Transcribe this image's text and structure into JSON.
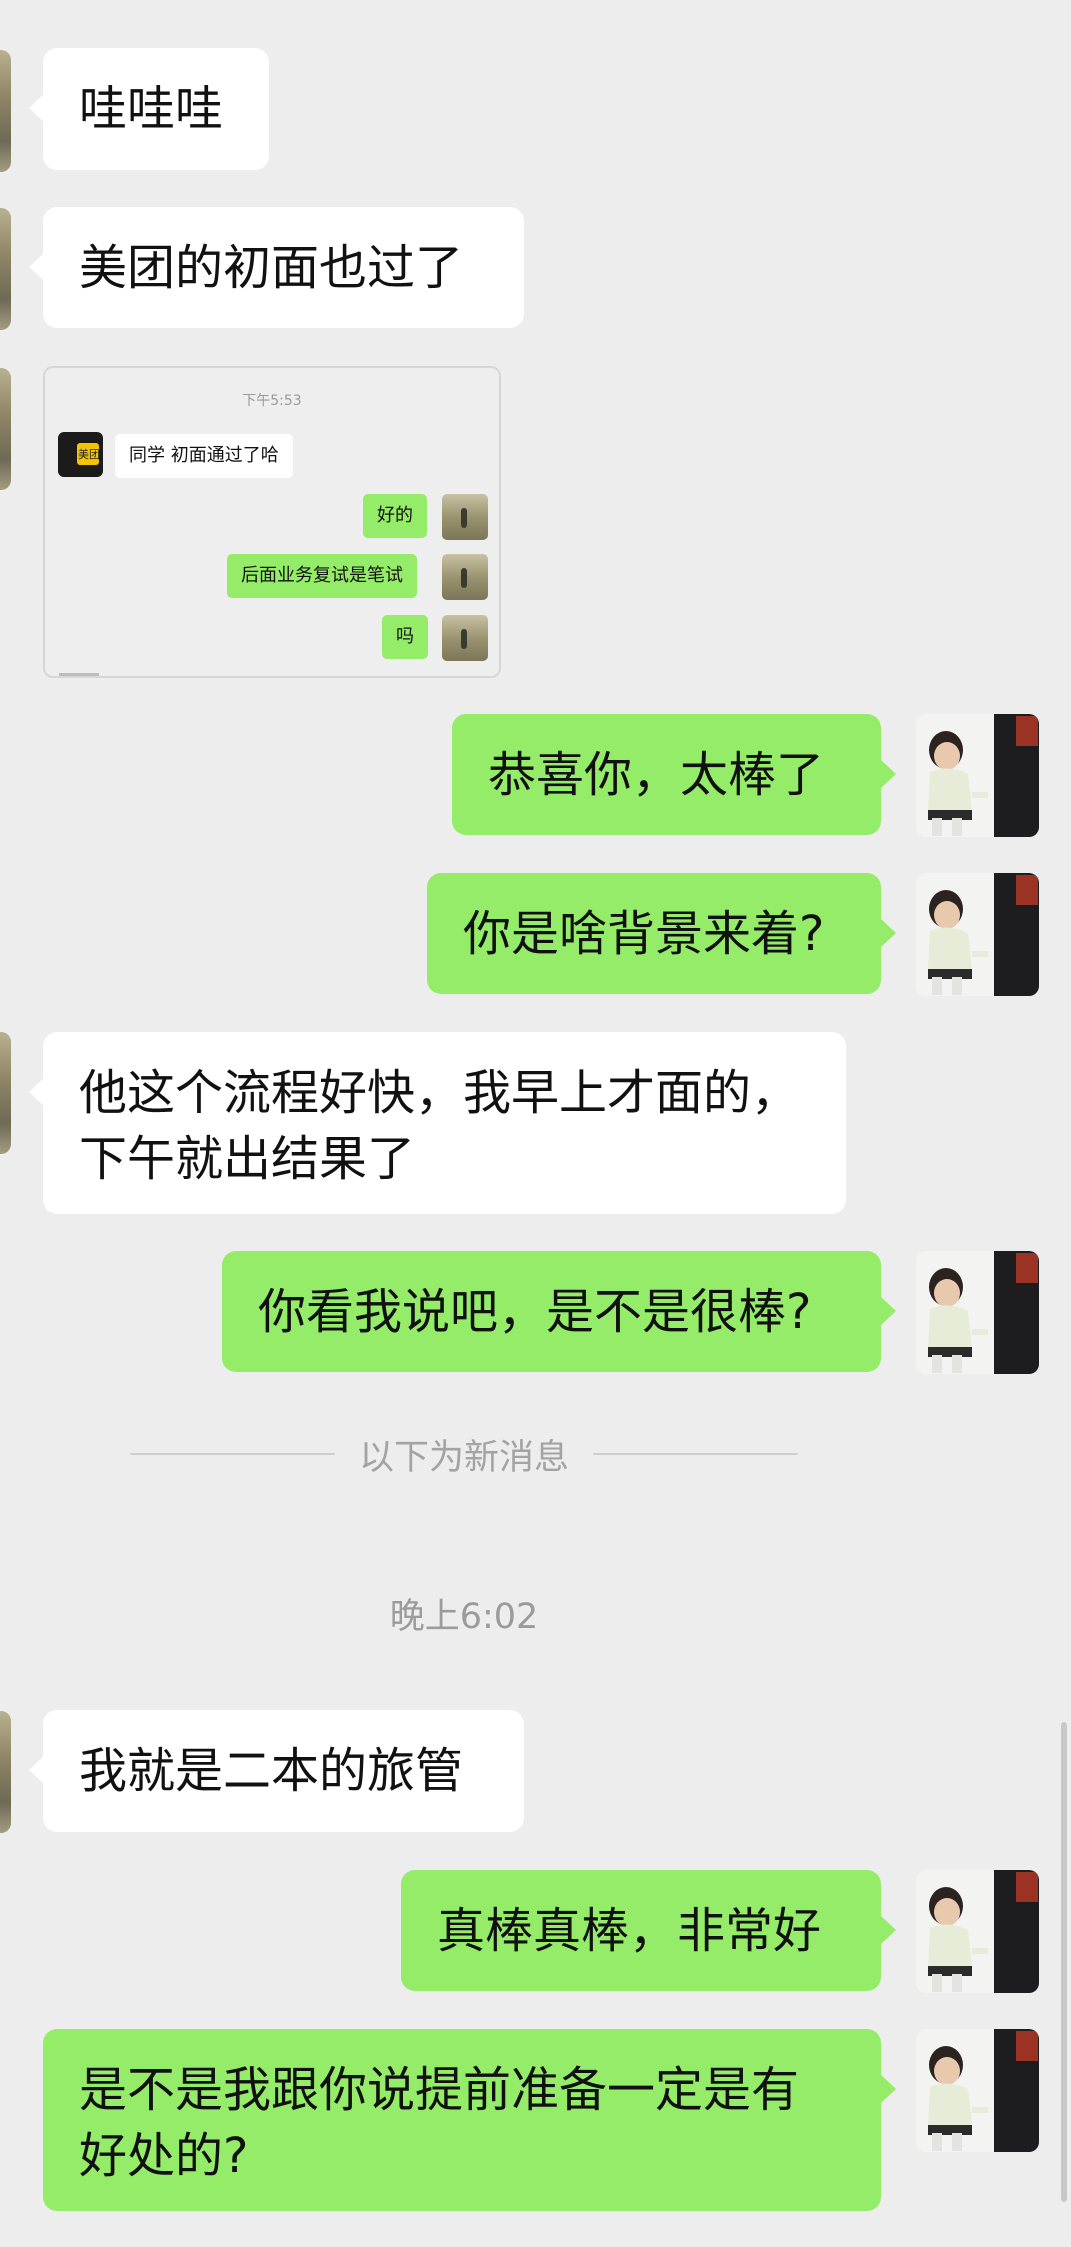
{
  "chat": {
    "messages": [
      {
        "side": "left",
        "text": "哇哇哇"
      },
      {
        "side": "left",
        "text": "美团的初面也过了"
      },
      {
        "side": "left",
        "type": "image"
      },
      {
        "side": "right",
        "text": "恭喜你，太棒了"
      },
      {
        "side": "right",
        "text": "你是啥背景来着?"
      },
      {
        "side": "left",
        "text": "他这个流程好快，我早上才面的，下午就出结果了"
      },
      {
        "side": "right",
        "text": "你看我说吧，是不是很棒?"
      },
      {
        "side": "left",
        "text": "我就是二本的旅管"
      },
      {
        "side": "right",
        "text": "真棒真棒，非常好"
      },
      {
        "side": "right",
        "text": "是不是我跟你说提前准备一定是有好处的?"
      }
    ],
    "divider_label": "以下为新消息",
    "timestamp": "晚上6:02"
  },
  "screenshot": {
    "time": "下午5:53",
    "logo_text": "美团",
    "incoming": "同学 初面通过了哈",
    "outgoing": [
      "好的",
      "后面业务复试是笔试",
      "吗"
    ]
  },
  "colors": {
    "background": "#ededed",
    "outgoing_bubble": "#95ec69",
    "incoming_bubble": "#ffffff"
  },
  "icons": {
    "self_avatar": "child-photo-avatar",
    "contact_avatar": "landscape-photo-avatar"
  }
}
